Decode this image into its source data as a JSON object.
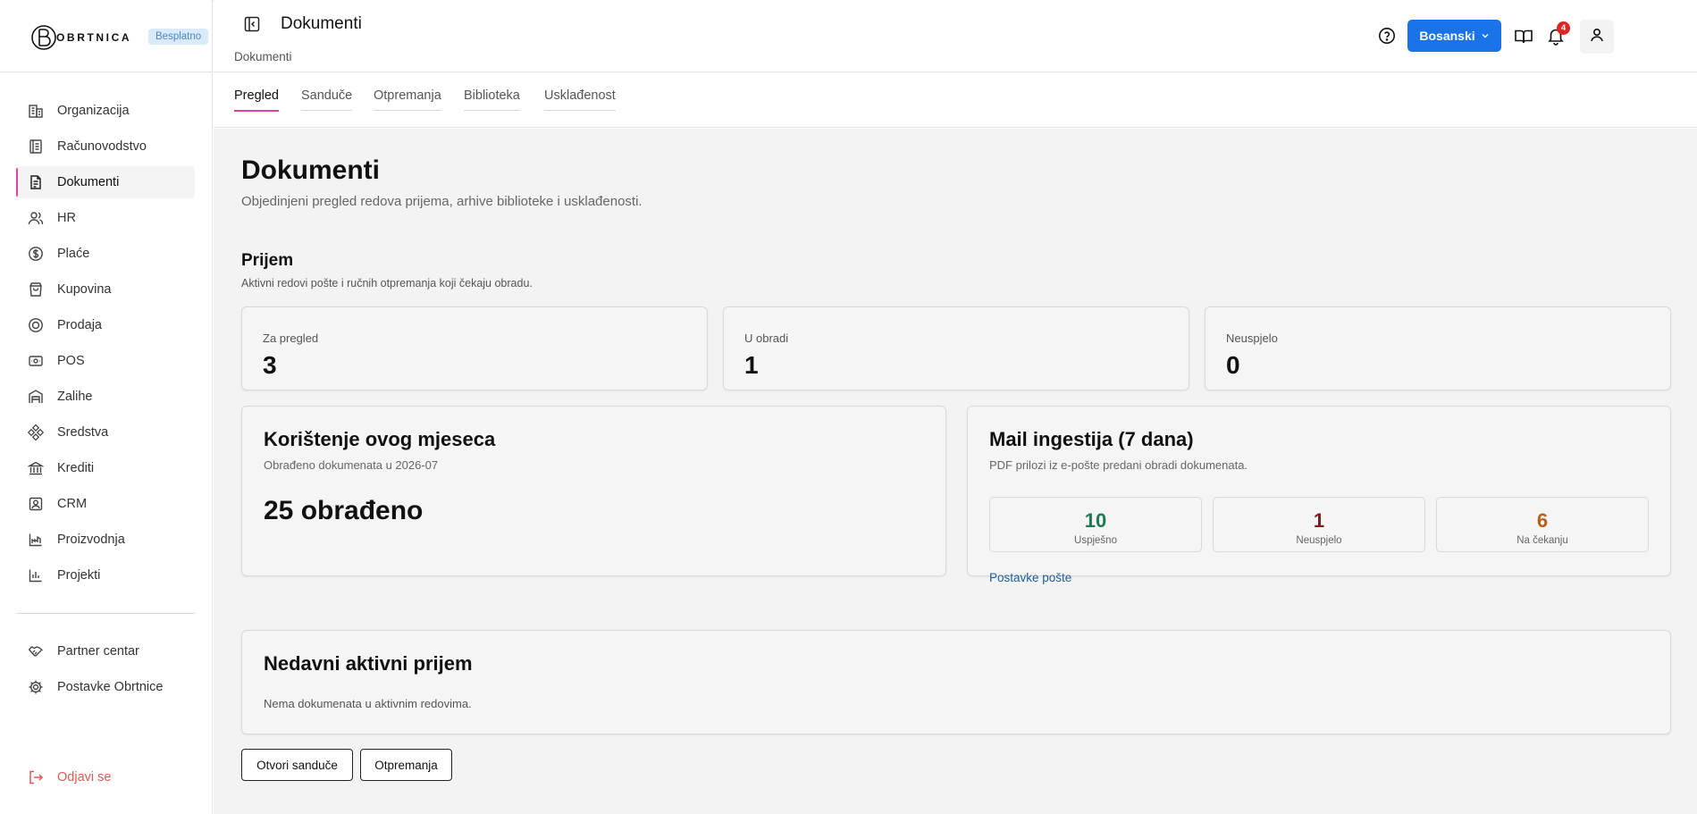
{
  "brand": {
    "logo_text": "OBRTNICA",
    "plan_badge": "Besplatno"
  },
  "sidebar": {
    "items": [
      {
        "label": "Organizacija",
        "icon": "building-icon",
        "active": false
      },
      {
        "label": "Računovodstvo",
        "icon": "ledger-icon",
        "active": false
      },
      {
        "label": "Dokumenti",
        "icon": "document-icon",
        "active": true
      },
      {
        "label": "HR",
        "icon": "users-icon",
        "active": false
      },
      {
        "label": "Plaće",
        "icon": "dollar-circle-icon",
        "active": false
      },
      {
        "label": "Kupovina",
        "icon": "shopping-bag-icon",
        "active": false
      },
      {
        "label": "Prodaja",
        "icon": "coin-icon",
        "active": false
      },
      {
        "label": "POS",
        "icon": "cash-register-icon",
        "active": false
      },
      {
        "label": "Zalihe",
        "icon": "warehouse-icon",
        "active": false
      },
      {
        "label": "Sredstva",
        "icon": "assets-icon",
        "active": false
      },
      {
        "label": "Krediti",
        "icon": "bank-icon",
        "active": false
      },
      {
        "label": "CRM",
        "icon": "contact-icon",
        "active": false
      },
      {
        "label": "Proizvodnja",
        "icon": "production-icon",
        "active": false
      },
      {
        "label": "Projekti",
        "icon": "project-icon",
        "active": false
      }
    ],
    "secondary": [
      {
        "label": "Partner centar",
        "icon": "handshake-icon"
      },
      {
        "label": "Postavke Obrtnice",
        "icon": "gear-icon"
      }
    ],
    "logout_label": "Odjavi se"
  },
  "header": {
    "title": "Dokumenti",
    "breadcrumb": "Dokumenti",
    "language": "Bosanski",
    "notification_count": "4"
  },
  "tabs": [
    {
      "label": "Pregled",
      "active": true
    },
    {
      "label": "Sanduče",
      "active": false
    },
    {
      "label": "Otpremanja",
      "active": false
    },
    {
      "label": "Biblioteka",
      "active": false
    },
    {
      "label": "Usklađenost",
      "active": false
    }
  ],
  "main": {
    "title": "Dokumenti",
    "subtitle": "Objedinjeni pregled redova prijema, arhive biblioteke i usklađenosti.",
    "intake": {
      "title": "Prijem",
      "subtitle": "Aktivni redovi pošte i ručnih otpremanja koji čekaju obradu.",
      "stats": [
        {
          "label": "Za pregled",
          "value": "3"
        },
        {
          "label": "U obradi",
          "value": "1"
        },
        {
          "label": "Neuspjelo",
          "value": "0"
        }
      ]
    },
    "usage": {
      "title": "Korištenje ovog mjeseca",
      "subtitle": "Obrađeno dokumenata u 2026-07",
      "value": "25 obrađeno"
    },
    "mail": {
      "title": "Mail ingestija (7 dana)",
      "subtitle": "PDF prilozi iz e-pošte predani obradi dokumenata.",
      "stats": [
        {
          "label": "Uspješno",
          "value": "10",
          "color": "#1c7a52"
        },
        {
          "label": "Neuspjelo",
          "value": "1",
          "color": "#7a2020"
        },
        {
          "label": "Na čekanju",
          "value": "6",
          "color": "#b5621b"
        }
      ],
      "link": "Postavke pošte"
    },
    "recent": {
      "title": "Nedavni aktivni prijem",
      "empty": "Nema dokumenata u aktivnim redovima."
    },
    "buttons": {
      "open_inbox": "Otvori sanduče",
      "dispatches": "Otpremanja"
    }
  },
  "colors": {
    "accent": "#d946a8",
    "primary": "#1a73e8",
    "danger": "#e02424",
    "logout": "#e05a55"
  }
}
